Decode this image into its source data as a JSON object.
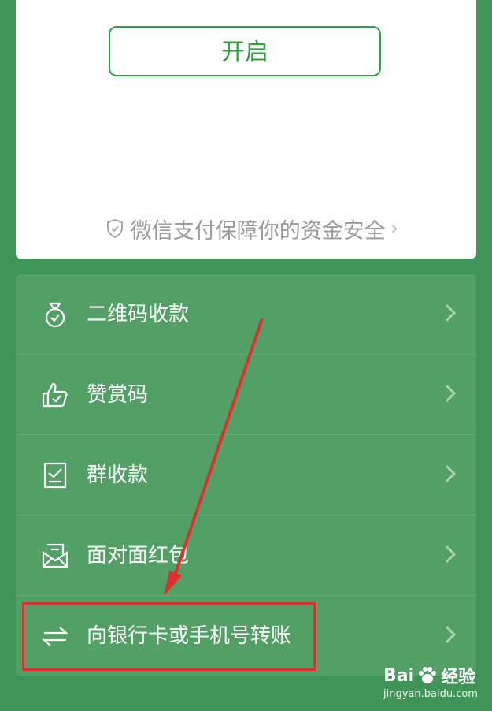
{
  "top_card": {
    "open_button": "开启",
    "safety_text": "微信支付保障你的资金安全",
    "safety_chevron": "›"
  },
  "menu": {
    "items": [
      {
        "label": "二维码收款",
        "icon": "money-bag-icon"
      },
      {
        "label": "赞赏码",
        "icon": "thumbs-up-icon"
      },
      {
        "label": "群收款",
        "icon": "group-receipt-icon"
      },
      {
        "label": "面对面红包",
        "icon": "red-packet-icon"
      },
      {
        "label": "向银行卡或手机号转账",
        "icon": "transfer-icon"
      }
    ]
  },
  "watermark": {
    "brand": "Bai",
    "brand_suffix": "经验",
    "url": "jingyan.baidu.com"
  },
  "colors": {
    "background": "#3f9557",
    "list_bg": "#52a066",
    "accent_green": "#2aa33b",
    "highlight_red": "#e0302d"
  }
}
